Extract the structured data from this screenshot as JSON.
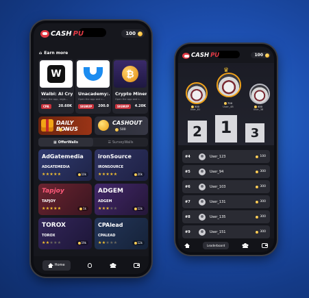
{
  "left_phone": {
    "app_name": {
      "part1": "CASH",
      "part2": "PU"
    },
    "balance": "100",
    "earn_more": "Earn more",
    "offers": [
      {
        "title": "Walbi: AI Cry...",
        "desc": "Open the app, regis...",
        "tag": "CPA",
        "amount": "20.60K",
        "tag_color": "#c8323c"
      },
      {
        "title": "Unacademy:...",
        "desc": "Open the app and c...",
        "tag": "SIGNUP",
        "amount": "200.0",
        "tag_color": "#c8323c"
      },
      {
        "title": "Crypto Miner ...",
        "desc": "Open the app and r...",
        "tag": "SIGNUP",
        "amount": "4.20K",
        "tag_color": "#c8323c"
      }
    ],
    "bonuses": [
      {
        "title": "DAILY BONUS",
        "value": "100"
      },
      {
        "title": "CASHOUT",
        "value": "500"
      }
    ],
    "tabs": [
      {
        "label": "OfferWalls"
      },
      {
        "label": "SurveyWalls"
      }
    ],
    "walls": [
      {
        "brand": "AdGatemedia",
        "name": "ADGATEMEDIA",
        "stars": 5,
        "reward": "10k",
        "bg": "#2b3460"
      },
      {
        "brand": "ironSource",
        "name": "IRONSOURCE",
        "stars": 5,
        "reward": "20k",
        "bg": "#2a2d55"
      },
      {
        "brand": "Tapjoy",
        "name": "TAPJOY",
        "stars": 5,
        "reward": "1k",
        "bg": "#5a1f2a"
      },
      {
        "brand": "ADGEM",
        "name": "ADGEM",
        "stars": 3,
        "reward": "12k",
        "bg": "#3b2458"
      },
      {
        "brand": "TOROX",
        "name": "TOROX",
        "stars": 2,
        "reward": "19k",
        "bg": "#2e2350"
      },
      {
        "brand": "CPAlead",
        "name": "CPALEAD",
        "stars": 2,
        "reward": "12k",
        "bg": "#21334f"
      }
    ],
    "nav": {
      "home": "Home"
    }
  },
  "right_phone": {
    "app_name": {
      "part1": "CASH",
      "part2": "PU"
    },
    "balance": "100",
    "top3": [
      {
        "user": "User_81",
        "points": "500"
      },
      {
        "user": "User_48",
        "points": "700"
      },
      {
        "user": "User_38",
        "points": "400"
      }
    ],
    "podium": [
      "2",
      "1",
      "3"
    ],
    "rows": [
      {
        "rank": "#4",
        "user": "User_123",
        "points": "100"
      },
      {
        "rank": "#5",
        "user": "User_94",
        "points": "300"
      },
      {
        "rank": "#6",
        "user": "User_103",
        "points": "300"
      },
      {
        "rank": "#7",
        "user": "User_131",
        "points": "300"
      },
      {
        "rank": "#8",
        "user": "User_135",
        "points": "300"
      },
      {
        "rank": "#9",
        "user": "User_151",
        "points": "300"
      }
    ],
    "nav": {
      "leaderboard": "Leaderboard"
    }
  },
  "colors": {
    "accent_red": "#e23a45",
    "coin": "#f2a516",
    "bg_blue": "#1d4fb0"
  }
}
